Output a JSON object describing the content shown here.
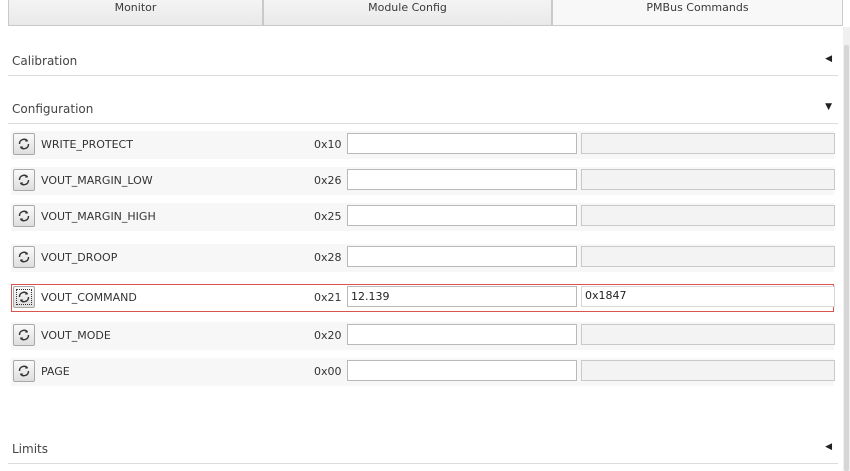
{
  "tabs": [
    {
      "label": "Monitor"
    },
    {
      "label": "Module Config"
    },
    {
      "label": "PMBus Commands",
      "active": true
    }
  ],
  "sections": {
    "calibration": {
      "title": "Calibration",
      "expanded": false
    },
    "configuration": {
      "title": "Configuration",
      "expanded": true
    },
    "limits": {
      "title": "Limits",
      "expanded": false
    }
  },
  "commands": [
    {
      "name": "WRITE_PROTECT",
      "code": "0x10",
      "value": "",
      "hex": ""
    },
    {
      "name": "VOUT_MARGIN_LOW",
      "code": "0x26",
      "value": "",
      "hex": ""
    },
    {
      "name": "VOUT_MARGIN_HIGH",
      "code": "0x25",
      "value": "",
      "hex": ""
    },
    {
      "name": "VOUT_DROOP",
      "code": "0x28",
      "value": "",
      "hex": ""
    },
    {
      "name": "VOUT_COMMAND",
      "code": "0x21",
      "value": "12.139",
      "hex": "0x1847",
      "selected": true
    },
    {
      "name": "VOUT_MODE",
      "code": "0x20",
      "value": "",
      "hex": ""
    },
    {
      "name": "PAGE",
      "code": "0x00",
      "value": "",
      "hex": ""
    }
  ],
  "icons": {
    "refresh": "refresh-icon",
    "collapsed": "triangle-left-icon",
    "expanded": "triangle-down-icon"
  },
  "colors": {
    "selected_border": "#d9534f"
  }
}
